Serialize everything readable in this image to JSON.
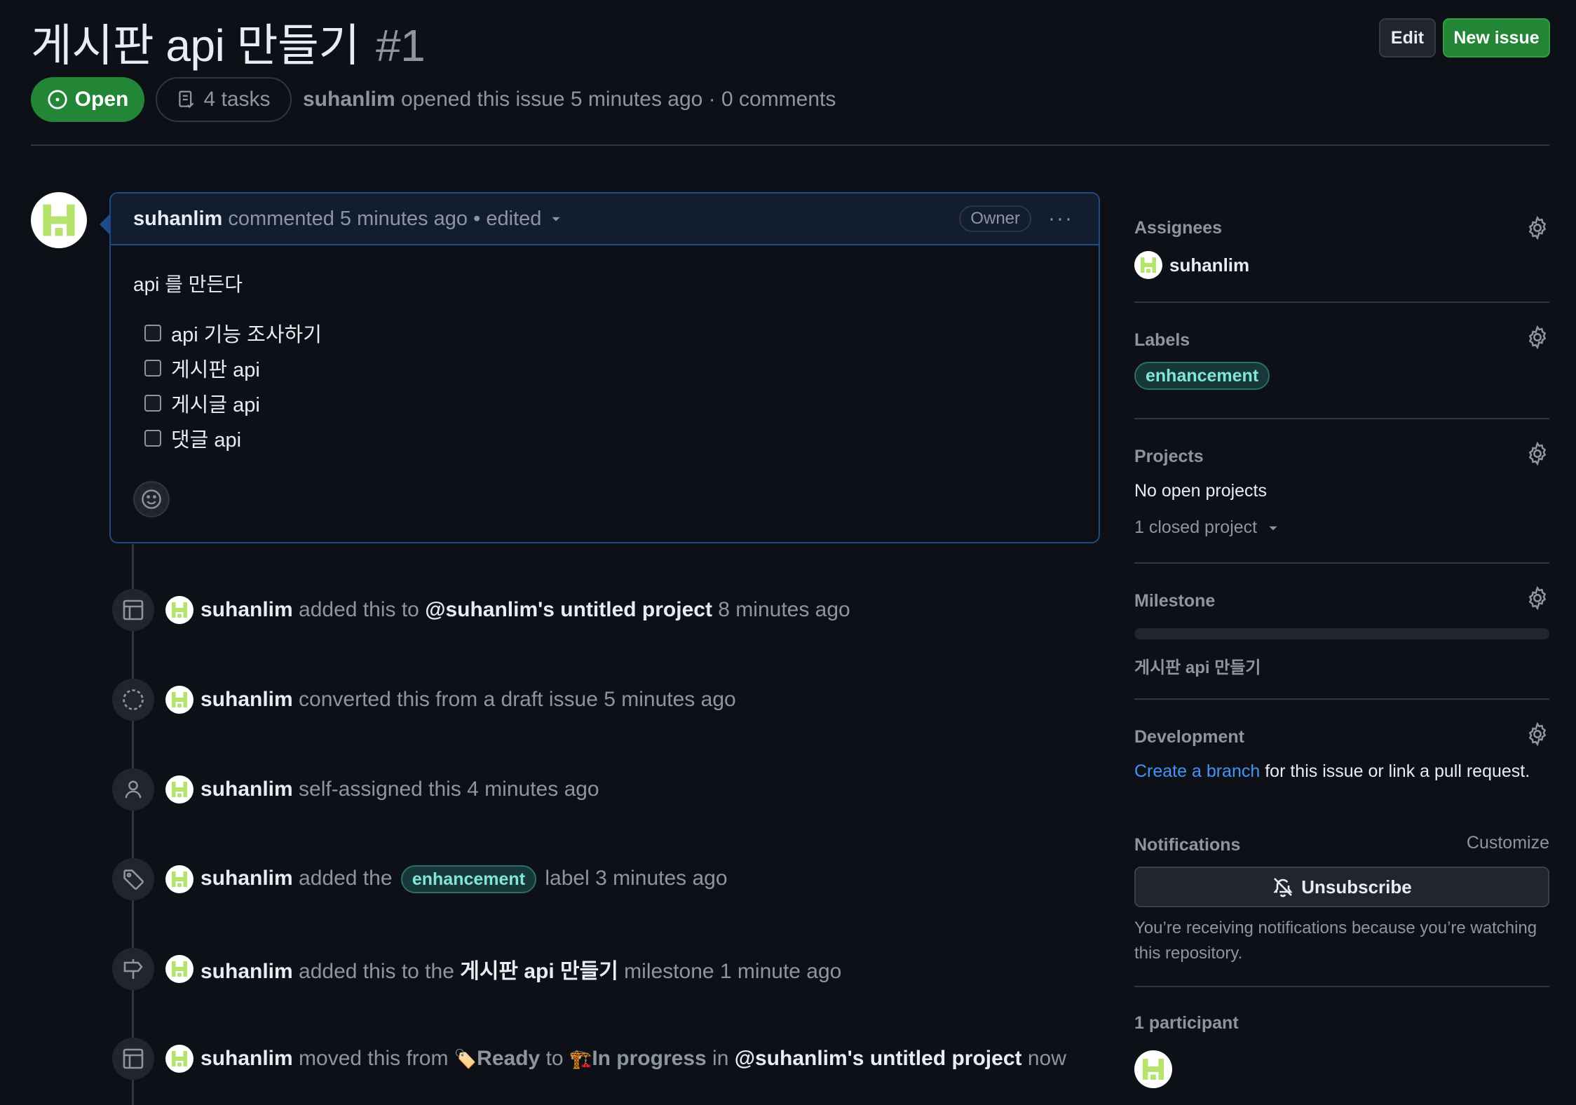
{
  "issue": {
    "title": "게시판 api 만들기",
    "number": "#1",
    "state": "Open",
    "tasks": "4 tasks",
    "author": "suhanlim",
    "meta_text": "opened this issue 5 minutes ago · 0 comments"
  },
  "header": {
    "edit_label": "Edit",
    "new_issue_label": "New issue"
  },
  "comment": {
    "author": "suhanlim",
    "meta": "commented 5 minutes ago • edited",
    "owner_badge": "Owner",
    "more": "···",
    "body": "api 를 만든다",
    "tasks": [
      "api 기능 조사하기",
      "게시판 api",
      "게시글 api",
      "댓글 api"
    ]
  },
  "timeline": [
    {
      "icon": "table-icon",
      "actor": "suhanlim",
      "parts": [
        {
          "t": "added this to ",
          "b": false
        },
        {
          "t": "@suhanlim's untitled project",
          "b": true
        },
        {
          "t": " 8 minutes ago",
          "b": false
        }
      ]
    },
    {
      "icon": "draft-circle-icon",
      "actor": "suhanlim",
      "parts": [
        {
          "t": "converted this from a draft issue 5 minutes ago",
          "b": false
        }
      ]
    },
    {
      "icon": "person-icon",
      "actor": "suhanlim",
      "parts": [
        {
          "t": "self-assigned this 4 minutes ago",
          "b": false
        }
      ]
    },
    {
      "icon": "tag-icon",
      "actor": "suhanlim",
      "label_before": "added the",
      "label": "enhancement",
      "label_after": "label 3 minutes ago"
    },
    {
      "icon": "milestone-icon",
      "actor": "suhanlim",
      "parts": [
        {
          "t": "added this to the ",
          "b": false
        },
        {
          "t": "게시판 api 만들기",
          "b": true
        },
        {
          "t": " milestone 1 minute ago",
          "b": false
        }
      ]
    },
    {
      "icon": "table-icon",
      "actor": "suhanlim",
      "moved": {
        "before": "moved this from",
        "from_emoji": "🏷️",
        "from": "Ready",
        "to_word": "to",
        "to_emoji": "🏗️",
        "to": "In progress",
        "in_word": "in",
        "project": "@suhanlim's untitled project",
        "when": "now"
      }
    }
  ],
  "sidebar": {
    "assignees": {
      "title": "Assignees",
      "user": "suhanlim"
    },
    "labels": {
      "title": "Labels",
      "label": "enhancement",
      "label_color": "#83e5d4"
    },
    "projects": {
      "title": "Projects",
      "open": "No open projects",
      "closed": "1 closed project"
    },
    "milestone": {
      "title": "Milestone",
      "name": "게시판 api 만들기",
      "progress": 0
    },
    "development": {
      "title": "Development",
      "link": "Create a branch",
      "rest": "for this issue or link a pull request."
    },
    "notifications": {
      "title": "Notifications",
      "customize": "Customize",
      "button": "Unsubscribe",
      "note": "You’re receiving notifications because you’re watching this repository."
    },
    "participants": {
      "title": "1 participant"
    }
  },
  "colors": {
    "background": "#0d1117",
    "open_green": "#238636",
    "link_blue": "#4493f8",
    "avatar_green": "#b6e36b"
  }
}
